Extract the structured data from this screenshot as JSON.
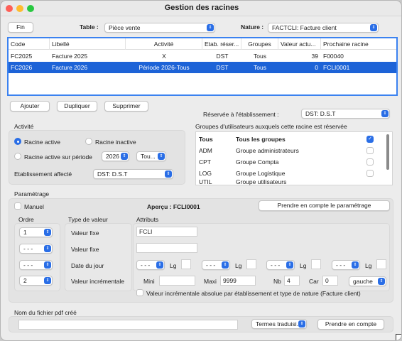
{
  "window": {
    "title": "Gestion des racines"
  },
  "toolbar": {
    "fin_label": "Fin",
    "table_label": "Table :",
    "table_value": "Pièce vente",
    "nature_label": "Nature :",
    "nature_value": "FACTCLI: Facture client"
  },
  "table": {
    "headers": [
      "Code",
      "Libellé",
      "Activité",
      "Etab. réser...",
      "Groupes",
      "Valeur actu...",
      "Prochaine racine"
    ],
    "rows": [
      [
        "FC2025",
        "Facture 2025",
        "X",
        "DST",
        "Tous",
        "39",
        "F00040"
      ],
      [
        "FC2026",
        "Facture 2026",
        "Période 2026-Tous",
        "DST",
        "Tous",
        "0",
        "FCLI0001"
      ]
    ],
    "selected_row": 1
  },
  "actions": {
    "ajouter": "Ajouter",
    "dupliquer": "Dupliquer",
    "supprimer": "Supprimer"
  },
  "reserve": {
    "label": "Réservée à l'établissement :",
    "value": "DST: D.S.T"
  },
  "activite": {
    "title": "Activité",
    "racine_active": "Racine active",
    "racine_inactive": "Racine inactive",
    "racine_active_periode": "Racine active sur période",
    "year": "2026",
    "period_scope": "Tou...",
    "selected": "Racine active",
    "etab_label": "Etablissement affecté",
    "etab_value": "DST: D.S.T"
  },
  "groupes": {
    "label": "Groupes d'utilisateurs auxquels cette racine est réservée",
    "rows": [
      {
        "code": "Tous",
        "name": "Tous les groupes",
        "checked": true
      },
      {
        "code": "ADM",
        "name": "Groupe administrateurs",
        "checked": false
      },
      {
        "code": "CPT",
        "name": "Groupe Compta",
        "checked": false
      },
      {
        "code": "LOG",
        "name": "Groupe Logistique",
        "checked": false
      },
      {
        "code": "UTIL",
        "name": "Groupe utilisateurs",
        "checked": false
      }
    ]
  },
  "parametrage": {
    "title": "Paramétrage",
    "manuel": "Manuel",
    "apercu_label": "Aperçu : FCLI0001",
    "prendre_param": "Prendre en compte le paramétrage",
    "ordre_label": "Ordre",
    "type_label": "Type de valeur",
    "attributs_label": "Attributs",
    "ordres": [
      "1",
      "- - -",
      "- - -",
      "2"
    ],
    "types": [
      "Valeur fixe",
      "Valeur fixe",
      "Date du jour",
      "Valeur incrémentale"
    ],
    "fixe_value": "FCLI",
    "dash": "- - -",
    "lg": "Lg",
    "mini_label": "Mini",
    "maxi_label": "Maxi",
    "maxi_value": "9999",
    "nb_label": "Nb",
    "nb_value": "4",
    "car_label": "Car",
    "car_value": "0",
    "align_value": "gauche",
    "increment_label": "Valeur incrémentale absolue par établissement et type de nature (Facture client)"
  },
  "pdf": {
    "label": "Nom du fichier pdf créé",
    "termes": "Termes traduisi...",
    "prendre": "Prendre en compte"
  }
}
